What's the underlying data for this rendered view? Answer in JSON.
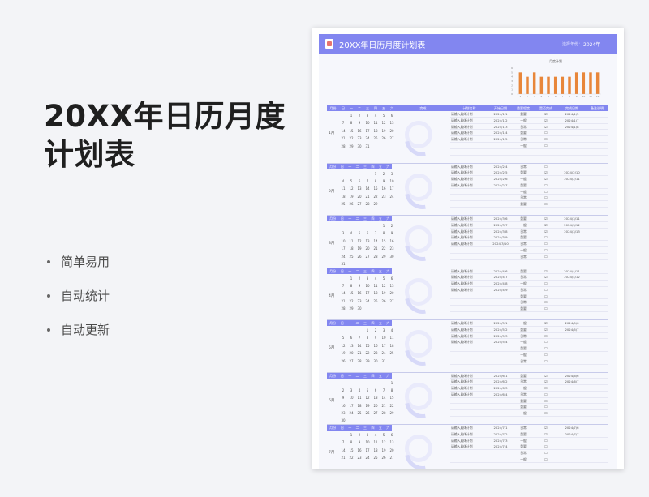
{
  "promo": {
    "title": "20XX年日历月度计划表",
    "features": [
      "简单易用",
      "自动统计",
      "自动更新"
    ]
  },
  "sheet": {
    "title": "20XX年日历月度计划表",
    "year_label": "选择年份：",
    "year_value": "2024年"
  },
  "chart_data": {
    "type": "bar",
    "title": "月度计划",
    "categories": [
      "1",
      "2",
      "3",
      "4",
      "5",
      "6",
      "7",
      "8",
      "9",
      "10",
      "11",
      "12"
    ],
    "values": [
      5,
      4,
      5,
      4,
      4,
      4,
      4,
      4,
      5,
      5,
      5,
      5
    ],
    "ylim": [
      0,
      6
    ],
    "y_ticks": [
      "0",
      "1",
      "2",
      "3",
      "4",
      "5",
      "6"
    ],
    "bar_color": "#e8863a"
  },
  "table": {
    "columns": [
      "月份",
      "日",
      "一",
      "二",
      "三",
      "四",
      "五",
      "六",
      "完成",
      "计划名称",
      "开始日期",
      "重要程度",
      "是否完成",
      "完成日期",
      "备注说明"
    ],
    "weekdays": [
      "日",
      "一",
      "二",
      "三",
      "四",
      "五",
      "六"
    ],
    "months": [
      {
        "label": "1月",
        "days": [
          "",
          "1",
          "2",
          "3",
          "4",
          "5",
          "6",
          "7",
          "8",
          "9",
          "10",
          "11",
          "12",
          "13",
          "14",
          "15",
          "16",
          "17",
          "18",
          "19",
          "20",
          "21",
          "22",
          "23",
          "24",
          "25",
          "26",
          "27",
          "28",
          "29",
          "30",
          "31"
        ],
        "plans": [
          {
            "name": "请输入具体计划",
            "start": "2024/1/1",
            "level": "重要",
            "done": "☑",
            "finish": "2024/1/5"
          },
          {
            "name": "请输入具体计划",
            "start": "2024/1/2",
            "level": "一般",
            "done": "☑",
            "finish": "2024/1/7"
          },
          {
            "name": "请输入具体计划",
            "start": "2024/1/3",
            "level": "日常",
            "done": "☑",
            "finish": "2024/1/8"
          },
          {
            "name": "请输入具体计划",
            "start": "2024/1/4",
            "level": "重要",
            "done": "☐",
            "finish": ""
          },
          {
            "name": "请输入具体计划",
            "start": "2024/1/5",
            "level": "日常",
            "done": "☐",
            "finish": ""
          },
          {
            "name": "",
            "start": "",
            "level": "一般",
            "done": "☐",
            "finish": ""
          },
          {
            "name": "",
            "start": "",
            "level": "",
            "done": "",
            "finish": ""
          }
        ]
      },
      {
        "label": "2月",
        "days": [
          "",
          "",
          "",
          "",
          "1",
          "2",
          "3",
          "4",
          "5",
          "6",
          "7",
          "8",
          "9",
          "10",
          "11",
          "12",
          "13",
          "14",
          "15",
          "16",
          "17",
          "18",
          "19",
          "20",
          "21",
          "22",
          "23",
          "24",
          "25",
          "26",
          "27",
          "28",
          "29"
        ],
        "plans": [
          {
            "name": "请输入具体计划",
            "start": "2024/2/4",
            "level": "日常",
            "done": "☐",
            "finish": ""
          },
          {
            "name": "请输入具体计划",
            "start": "2024/2/5",
            "level": "重要",
            "done": "☑",
            "finish": "2024/2/10"
          },
          {
            "name": "请输入具体计划",
            "start": "2024/2/6",
            "level": "一般",
            "done": "☑",
            "finish": "2024/2/11"
          },
          {
            "name": "请输入具体计划",
            "start": "2024/2/7",
            "level": "重要",
            "done": "☐",
            "finish": ""
          },
          {
            "name": "",
            "start": "",
            "level": "一般",
            "done": "☐",
            "finish": ""
          },
          {
            "name": "",
            "start": "",
            "level": "日常",
            "done": "☐",
            "finish": ""
          },
          {
            "name": "",
            "start": "",
            "level": "重要",
            "done": "☐",
            "finish": ""
          }
        ]
      },
      {
        "label": "3月",
        "days": [
          "",
          "",
          "",
          "",
          "",
          "1",
          "2",
          "3",
          "4",
          "5",
          "6",
          "7",
          "8",
          "9",
          "10",
          "11",
          "12",
          "13",
          "14",
          "15",
          "16",
          "17",
          "18",
          "19",
          "20",
          "21",
          "22",
          "23",
          "24",
          "25",
          "26",
          "27",
          "28",
          "29",
          "30",
          "31"
        ],
        "plans": [
          {
            "name": "请输入具体计划",
            "start": "2024/3/6",
            "level": "重要",
            "done": "☑",
            "finish": "2024/3/11"
          },
          {
            "name": "请输入具体计划",
            "start": "2024/3/7",
            "level": "一般",
            "done": "☑",
            "finish": "2024/3/12"
          },
          {
            "name": "请输入具体计划",
            "start": "2024/3/8",
            "level": "日常",
            "done": "☑",
            "finish": "2024/3/13"
          },
          {
            "name": "请输入具体计划",
            "start": "2024/3/9",
            "level": "重要",
            "done": "☐",
            "finish": ""
          },
          {
            "name": "请输入具体计划",
            "start": "2024/3/10",
            "level": "日常",
            "done": "☐",
            "finish": ""
          },
          {
            "name": "",
            "start": "",
            "level": "一般",
            "done": "☐",
            "finish": ""
          },
          {
            "name": "",
            "start": "",
            "level": "日常",
            "done": "☐",
            "finish": ""
          }
        ]
      },
      {
        "label": "4月",
        "days": [
          "",
          "1",
          "2",
          "3",
          "4",
          "5",
          "6",
          "7",
          "8",
          "9",
          "10",
          "11",
          "12",
          "13",
          "14",
          "15",
          "16",
          "17",
          "18",
          "19",
          "20",
          "21",
          "22",
          "23",
          "24",
          "25",
          "26",
          "27",
          "28",
          "29",
          "30"
        ],
        "plans": [
          {
            "name": "请输入具体计划",
            "start": "2024/4/6",
            "level": "重要",
            "done": "☑",
            "finish": "2024/4/11"
          },
          {
            "name": "请输入具体计划",
            "start": "2024/4/7",
            "level": "日常",
            "done": "☑",
            "finish": "2024/4/12"
          },
          {
            "name": "请输入具体计划",
            "start": "2024/4/8",
            "level": "一般",
            "done": "☐",
            "finish": ""
          },
          {
            "name": "请输入具体计划",
            "start": "2024/4/9",
            "level": "日常",
            "done": "☐",
            "finish": ""
          },
          {
            "name": "",
            "start": "",
            "level": "重要",
            "done": "☐",
            "finish": ""
          },
          {
            "name": "",
            "start": "",
            "level": "日常",
            "done": "☐",
            "finish": ""
          },
          {
            "name": "",
            "start": "",
            "level": "重要",
            "done": "☐",
            "finish": ""
          }
        ]
      },
      {
        "label": "5月",
        "days": [
          "",
          "",
          "",
          "1",
          "2",
          "3",
          "4",
          "5",
          "6",
          "7",
          "8",
          "9",
          "10",
          "11",
          "12",
          "13",
          "14",
          "15",
          "16",
          "17",
          "18",
          "19",
          "20",
          "21",
          "22",
          "23",
          "24",
          "25",
          "26",
          "27",
          "28",
          "29",
          "30",
          "31"
        ],
        "plans": [
          {
            "name": "请输入具体计划",
            "start": "2024/5/1",
            "level": "一般",
            "done": "☑",
            "finish": "2024/5/6"
          },
          {
            "name": "请输入具体计划",
            "start": "2024/5/2",
            "level": "重要",
            "done": "☑",
            "finish": "2024/5/7"
          },
          {
            "name": "请输入具体计划",
            "start": "2024/5/3",
            "level": "日常",
            "done": "☐",
            "finish": ""
          },
          {
            "name": "请输入具体计划",
            "start": "2024/5/4",
            "level": "一般",
            "done": "☐",
            "finish": ""
          },
          {
            "name": "",
            "start": "",
            "level": "重要",
            "done": "☐",
            "finish": ""
          },
          {
            "name": "",
            "start": "",
            "level": "一般",
            "done": "☐",
            "finish": ""
          },
          {
            "name": "",
            "start": "",
            "level": "日常",
            "done": "☐",
            "finish": ""
          }
        ]
      },
      {
        "label": "6月",
        "days": [
          "",
          "",
          "",
          "",
          "",
          "",
          "1",
          "2",
          "3",
          "4",
          "5",
          "6",
          "7",
          "8",
          "9",
          "10",
          "11",
          "12",
          "13",
          "14",
          "15",
          "16",
          "17",
          "18",
          "19",
          "20",
          "21",
          "22",
          "23",
          "24",
          "25",
          "26",
          "27",
          "28",
          "29",
          "30"
        ],
        "plans": [
          {
            "name": "请输入具体计划",
            "start": "2024/6/1",
            "level": "重要",
            "done": "☑",
            "finish": "2024/6/6"
          },
          {
            "name": "请输入具体计划",
            "start": "2024/6/2",
            "level": "日常",
            "done": "☑",
            "finish": "2024/6/7"
          },
          {
            "name": "请输入具体计划",
            "start": "2024/6/3",
            "level": "一般",
            "done": "☐",
            "finish": ""
          },
          {
            "name": "请输入具体计划",
            "start": "2024/6/4",
            "level": "日常",
            "done": "☐",
            "finish": ""
          },
          {
            "name": "",
            "start": "",
            "level": "重要",
            "done": "☐",
            "finish": ""
          },
          {
            "name": "",
            "start": "",
            "level": "重要",
            "done": "☐",
            "finish": ""
          },
          {
            "name": "",
            "start": "",
            "level": "一般",
            "done": "☐",
            "finish": ""
          }
        ]
      },
      {
        "label": "7月",
        "days": [
          "",
          "1",
          "2",
          "3",
          "4",
          "5",
          "6",
          "7",
          "8",
          "9",
          "10",
          "11",
          "12",
          "13",
          "14",
          "15",
          "16",
          "17",
          "18",
          "19",
          "20",
          "21",
          "22",
          "23",
          "24",
          "25",
          "26",
          "27"
        ],
        "plans": [
          {
            "name": "请输入具体计划",
            "start": "2024/7/1",
            "level": "日常",
            "done": "☑",
            "finish": "2024/7/6"
          },
          {
            "name": "请输入具体计划",
            "start": "2024/7/2",
            "level": "重要",
            "done": "☑",
            "finish": "2024/7/7"
          },
          {
            "name": "请输入具体计划",
            "start": "2024/7/3",
            "level": "一般",
            "done": "☐",
            "finish": ""
          },
          {
            "name": "请输入具体计划",
            "start": "2024/7/4",
            "level": "重要",
            "done": "☐",
            "finish": ""
          },
          {
            "name": "",
            "start": "",
            "level": "日常",
            "done": "☐",
            "finish": ""
          },
          {
            "name": "",
            "start": "",
            "level": "一般",
            "done": "☐",
            "finish": ""
          },
          {
            "name": "",
            "start": "",
            "level": "",
            "done": "",
            "finish": ""
          }
        ]
      }
    ]
  }
}
